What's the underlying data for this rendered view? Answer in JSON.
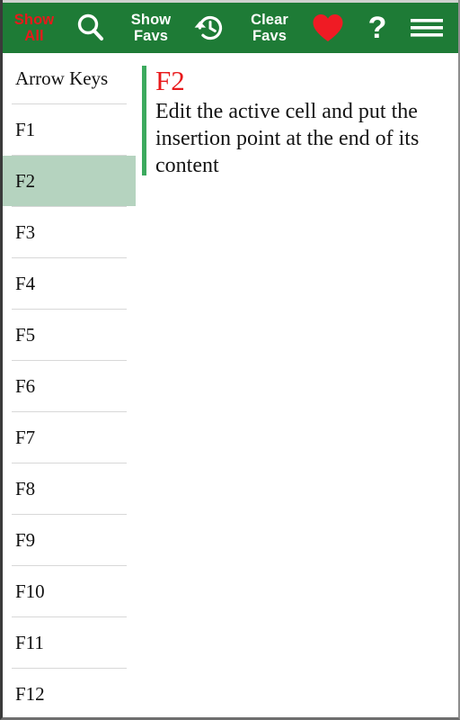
{
  "toolbar": {
    "items": [
      {
        "name": "show-all",
        "type": "text",
        "lines": [
          "Show",
          "All"
        ],
        "color": "#e8191b"
      },
      {
        "name": "search",
        "type": "icon",
        "icon": "search-icon"
      },
      {
        "name": "show-favs",
        "type": "text",
        "lines": [
          "Show",
          "Favs"
        ],
        "color": "#ffffff"
      },
      {
        "name": "history",
        "type": "icon",
        "icon": "history-icon"
      },
      {
        "name": "clear-favs",
        "type": "text",
        "lines": [
          "Clear",
          "Favs"
        ],
        "color": "#ffffff"
      },
      {
        "name": "favorite",
        "type": "icon",
        "icon": "heart-icon"
      },
      {
        "name": "help",
        "type": "icon",
        "icon": "question-mark-icon",
        "glyph": "?"
      },
      {
        "name": "menu",
        "type": "icon",
        "icon": "hamburger-menu-icon"
      }
    ],
    "background_color": "#1E7B36"
  },
  "sidebar": {
    "items": [
      {
        "label": "Arrow Keys",
        "selected": false
      },
      {
        "label": "F1",
        "selected": false
      },
      {
        "label": "F2",
        "selected": true
      },
      {
        "label": "F3",
        "selected": false
      },
      {
        "label": "F4",
        "selected": false
      },
      {
        "label": "F5",
        "selected": false
      },
      {
        "label": "F6",
        "selected": false
      },
      {
        "label": "F7",
        "selected": false
      },
      {
        "label": "F8",
        "selected": false
      },
      {
        "label": "F9",
        "selected": false
      },
      {
        "label": "F10",
        "selected": false
      },
      {
        "label": "F11",
        "selected": false
      },
      {
        "label": "F12",
        "selected": false
      }
    ],
    "selected_background_color": "#b5d3bf"
  },
  "detail": {
    "title": "F2",
    "title_color": "#e8191b",
    "description": "Edit the active cell and put the insertion point at the end of its content",
    "accent_color": "#3CAA5E"
  }
}
